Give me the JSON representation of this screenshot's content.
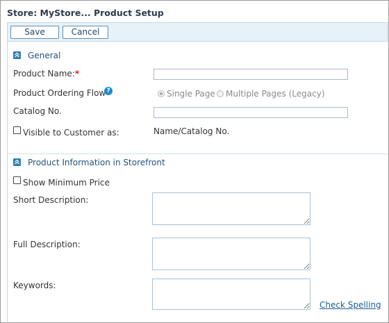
{
  "window": {
    "title": "Store: MyStore... Product Setup"
  },
  "toolbar": {
    "save_label": "Save",
    "cancel_label": "Cancel"
  },
  "general": {
    "section_title": "General",
    "product_name_label": "Product Name:",
    "required_marker": "*",
    "product_name_value": "",
    "ordering_flow_label": "Product Ordering Flow",
    "help_glyph": "?",
    "ordering_options": [
      {
        "label": "Single Page",
        "selected": true
      },
      {
        "label": "Multiple Pages (Legacy)",
        "selected": false
      }
    ],
    "catalog_no_label": "Catalog No.",
    "catalog_no_value": "",
    "visible_label": "Visible to Customer as:",
    "visible_checked": false,
    "visible_value": "Name/Catalog No."
  },
  "storefront": {
    "section_title": "Product Information in Storefront",
    "show_min_price_label": "Show Minimum Price",
    "show_min_price_checked": false,
    "short_desc_label": "Short Description:",
    "full_desc_label": "Full Description:",
    "keywords_label": "Keywords:",
    "check_spelling_label": "Check Spelling"
  },
  "icons": {
    "collapse": "collapse-up-icon",
    "help": "help-icon"
  },
  "colors": {
    "accent": "#2e7fb0",
    "toolbar_bg": "#e7f2f8",
    "link": "#1a5f93",
    "required": "#d62121"
  }
}
